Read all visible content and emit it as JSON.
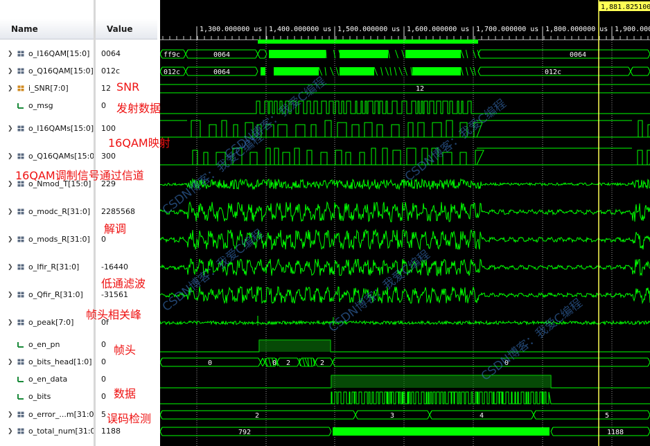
{
  "header": {
    "name_col": "Name",
    "value_col": "Value"
  },
  "cursor": {
    "readout": "1,881.825100"
  },
  "time_ticks": [
    "1,300.000000 us",
    "1,400.000000 us",
    "1,500.000000 us",
    "1,600.000000 us",
    "1,700.000000 us",
    "1,800.000000 us",
    "1,900.000"
  ],
  "colors": {
    "wave": "#00ff00",
    "cursor": "#ffff55",
    "annotation": "#ee1111",
    "watermark": "#3c7ac8"
  },
  "signals": [
    {
      "name": "o_I16QAM[15:0]",
      "value": "0064",
      "expandable": true,
      "icon": "bus-icon"
    },
    {
      "name": "o_Q16QAM[15:0]",
      "value": "012c",
      "expandable": true,
      "icon": "bus-icon"
    },
    {
      "name": "i_SNR[7:0]",
      "value": "12",
      "expandable": true,
      "icon": "input-bus-icon"
    },
    {
      "name": "o_msg",
      "value": "0",
      "expandable": false,
      "icon": "bit-icon"
    },
    {
      "name": "o_I16QAMs[15:0]",
      "value": "100",
      "expandable": true,
      "icon": "bus-icon"
    },
    {
      "name": "o_Q16QAMs[15:0",
      "value": "300",
      "expandable": true,
      "icon": "bus-icon"
    },
    {
      "name": "o_Nmod_T[15:0]",
      "value": "229",
      "expandable": true,
      "icon": "bus-icon"
    },
    {
      "name": "o_modc_R[31:0]",
      "value": "2285568",
      "expandable": true,
      "icon": "bus-icon"
    },
    {
      "name": "o_mods_R[31:0]",
      "value": "0",
      "expandable": true,
      "icon": "bus-icon"
    },
    {
      "name": "o_Ifir_R[31:0]",
      "value": "-16440",
      "expandable": true,
      "icon": "bus-icon"
    },
    {
      "name": "o_Qfir_R[31:0]",
      "value": "-31561",
      "expandable": true,
      "icon": "bus-icon"
    },
    {
      "name": "o_peak[7:0]",
      "value": "0f",
      "expandable": true,
      "icon": "bus-icon"
    },
    {
      "name": "o_en_pn",
      "value": "0",
      "expandable": false,
      "icon": "bit-icon"
    },
    {
      "name": "o_bits_head[1:0]",
      "value": "0",
      "expandable": true,
      "icon": "bus-icon"
    },
    {
      "name": "o_en_data",
      "value": "0",
      "expandable": false,
      "icon": "bit-icon"
    },
    {
      "name": "o_bits",
      "value": "0",
      "expandable": false,
      "icon": "bit-icon"
    },
    {
      "name": "o_error_...m[31:0",
      "value": "5",
      "expandable": true,
      "icon": "bus-icon"
    },
    {
      "name": "o_total_num[31:0",
      "value": "1188",
      "expandable": true,
      "icon": "bus-icon"
    }
  ],
  "wave_labels": {
    "i16_left": "ff9c",
    "i16_a": "0064",
    "i16_b": "0064",
    "q16_left": "012c",
    "q16_a": "0064",
    "q16_b": "012c",
    "snr": "12",
    "bh_a": "0",
    "bh_b": "0",
    "bh_c": "2",
    "bh_d": "0",
    "err_a": "2",
    "err_b": "3",
    "err_c": "4",
    "err_d": "5",
    "tot_a": "792",
    "tot_b": "1188"
  },
  "annotations": {
    "snr": "SNR",
    "msg": "发射数据",
    "map": "16QAM映射",
    "chan": "16QAM调制信号通过信道",
    "demod": "解调",
    "lpf": "低通滤波",
    "peak": "帧头相关峰",
    "head": "帧头",
    "data": "数据",
    "err": "误码检测"
  },
  "watermark": "CSDN博客：我爱C编程"
}
